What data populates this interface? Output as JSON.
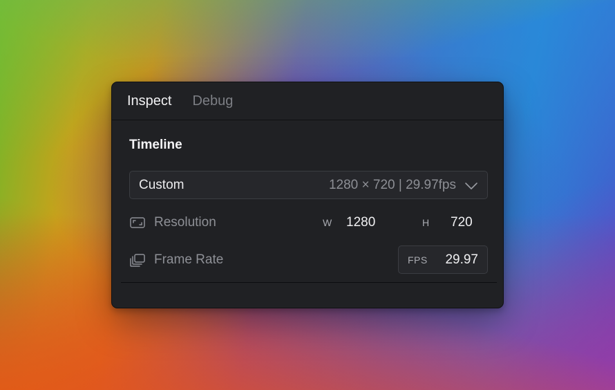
{
  "tabs": [
    {
      "label": "Inspect",
      "active": true
    },
    {
      "label": "Debug",
      "active": false
    }
  ],
  "section": {
    "title": "Timeline"
  },
  "preset": {
    "name": "Custom",
    "summary": "1280 × 720 | 29.97fps",
    "icon": "chevron-down-icon"
  },
  "resolution": {
    "label": "Resolution",
    "icon": "resolution-icon",
    "width_tag": "W",
    "width_value": "1280",
    "height_tag": "H",
    "height_value": "720"
  },
  "frame_rate": {
    "label": "Frame Rate",
    "icon": "frame-rate-icon",
    "unit_tag": "FPS",
    "value": "29.97"
  },
  "colors": {
    "panel_bg": "#202124",
    "field_border": "#3b3d42",
    "text_primary": "#f0f0f2",
    "text_secondary": "#8e9096"
  }
}
